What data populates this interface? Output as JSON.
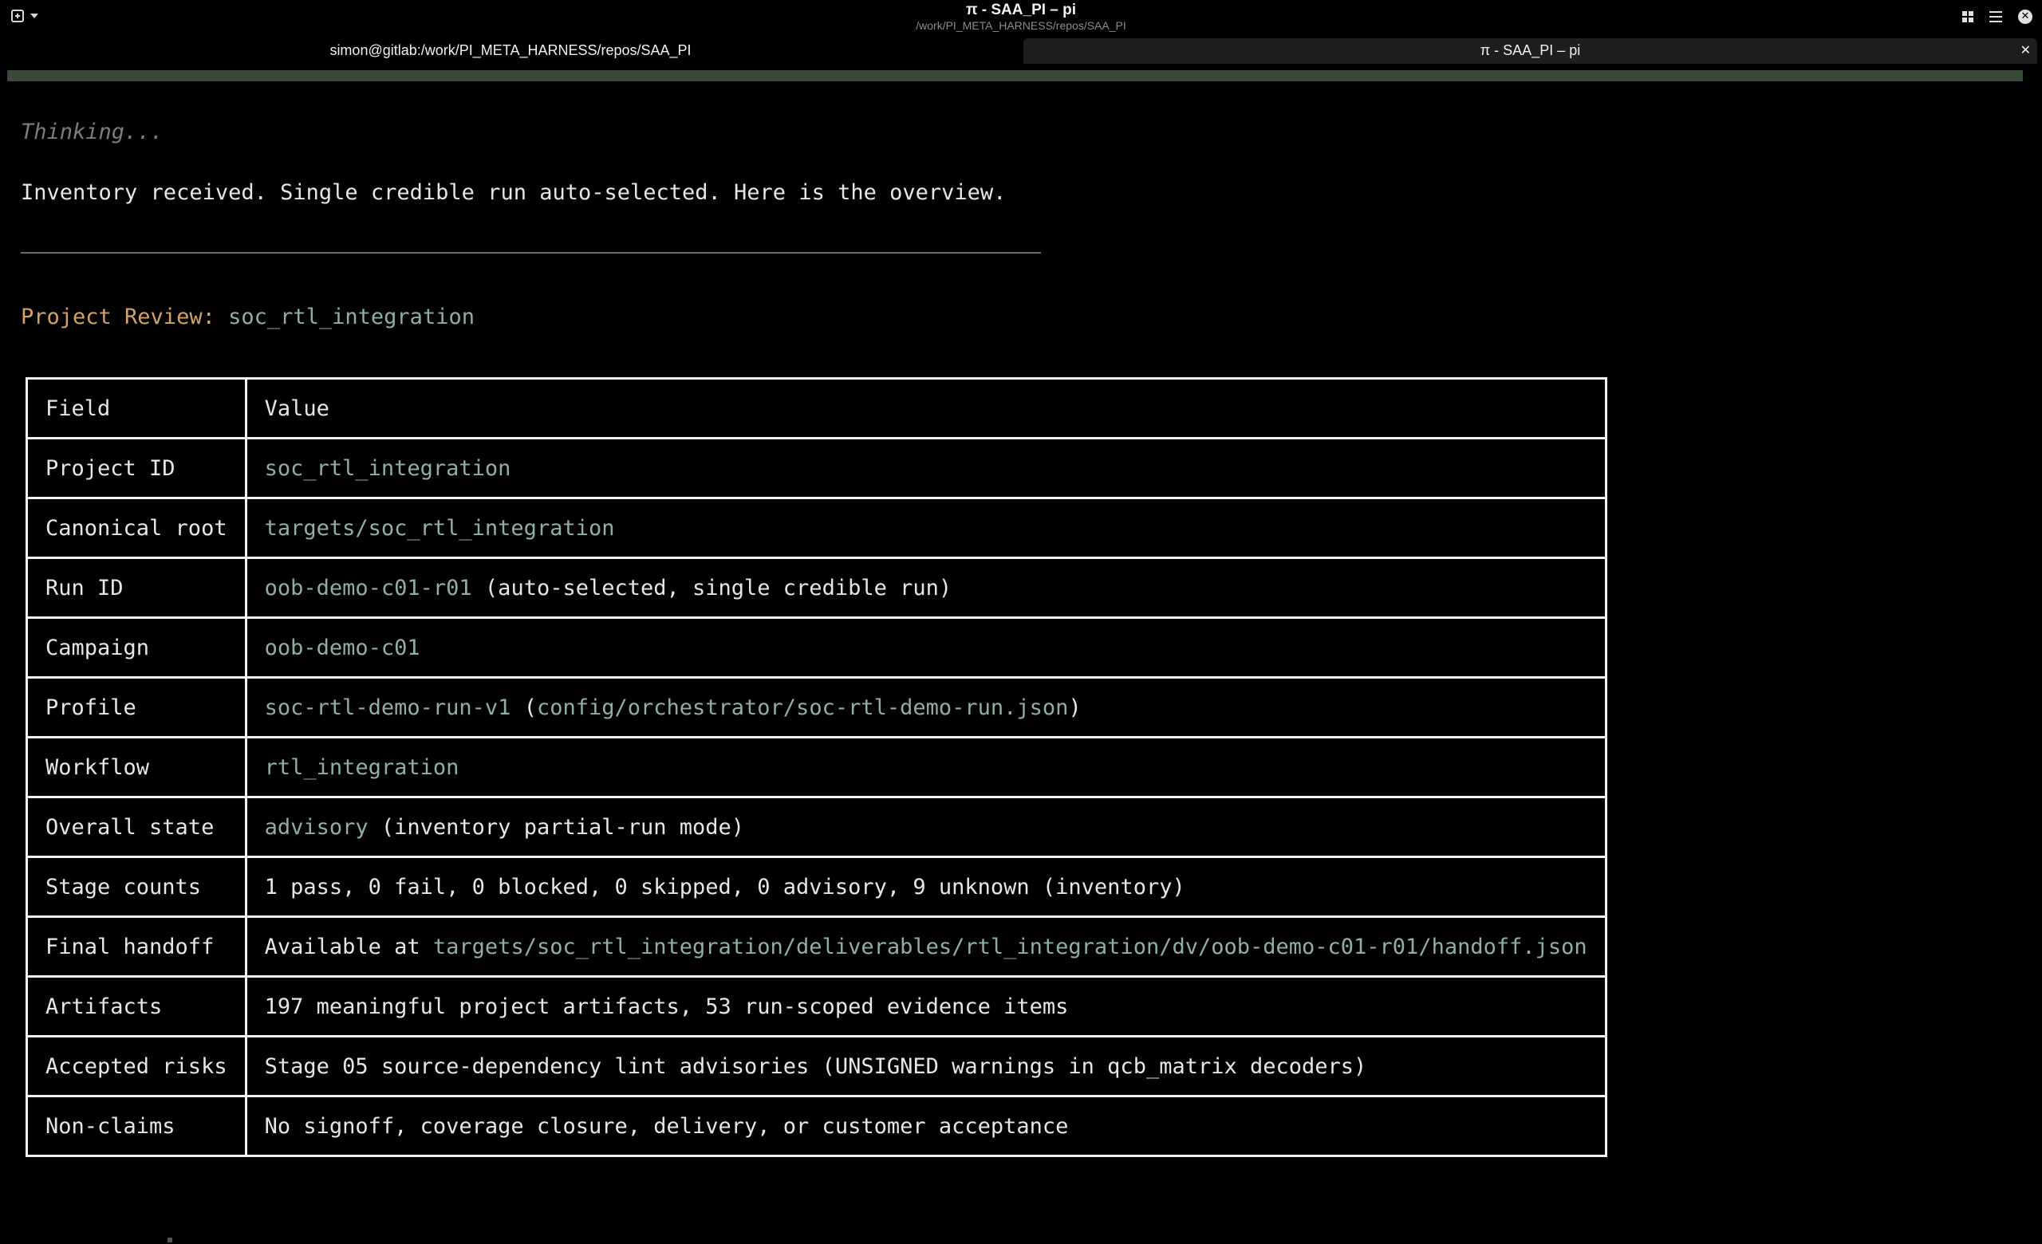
{
  "window": {
    "title": "π - SAA_PI – pi",
    "subtitle": "/work/PI_META_HARNESS/repos/SAA_PI"
  },
  "tabs": [
    {
      "label": "simon@gitlab:/work/PI_META_HARNESS/repos/SAA_PI",
      "active": false
    },
    {
      "label": "π - SAA_PI – pi",
      "active": true
    }
  ],
  "icons": {
    "new_tab": "new-tab-icon",
    "tab_menu": "chevron-down-icon",
    "view_grid": "grid-icon",
    "menu": "hamburger-menu-icon",
    "close_window": "close-icon",
    "close_tab": "close-icon"
  },
  "colors": {
    "background": "#000000",
    "text": "#e6e6e6",
    "muted": "#7c7c7c",
    "heading_label": "#d3a266",
    "highlight": "#8fb0a0",
    "table_border": "#f2f2f2"
  },
  "terminal": {
    "thinking": "Thinking...",
    "message": "Inventory received. Single credible run auto-selected. Here is the overview.",
    "review_label": "Project Review:",
    "review_project": "soc_rtl_integration"
  },
  "table": {
    "header": {
      "field": "Field",
      "value": "Value"
    },
    "rows": [
      {
        "field": "Project ID",
        "v1": "soc_rtl_integration"
      },
      {
        "field": "Canonical root",
        "v1": "targets/soc_rtl_integration"
      },
      {
        "field": "Run ID",
        "v1": "oob-demo-c01-r01",
        "v2": " (auto-selected, single credible run)"
      },
      {
        "field": "Campaign",
        "v1": "oob-demo-c01"
      },
      {
        "field": "Profile",
        "v1": "soc-rtl-demo-run-v1",
        "v2": " (",
        "v3": "config/orchestrator/soc-rtl-demo-run.json",
        "v4": ")"
      },
      {
        "field": "Workflow",
        "v1": "rtl_integration"
      },
      {
        "field": "Overall state",
        "v1": "advisory",
        "v2": " (inventory partial-run mode)"
      },
      {
        "field": "Stage counts",
        "v1": "1 pass, 0 fail, 0 blocked, 0 skipped, 0 advisory, 9 unknown (inventory)"
      },
      {
        "field": "Final handoff",
        "v1": "Available at ",
        "v2": "targets/soc_rtl_integration/deliverables/rtl_integration/dv/oob-demo-c01-r01/handoff.json"
      },
      {
        "field": "Artifacts",
        "v1": "197 meaningful project artifacts, 53 run-scoped evidence items"
      },
      {
        "field": "Accepted risks",
        "v1": "Stage 05 source-dependency lint advisories (UNSIGNED warnings in qcb_matrix decoders)"
      },
      {
        "field": "Non-claims",
        "v1": "No signoff, coverage closure, delivery, or customer acceptance"
      }
    ]
  }
}
